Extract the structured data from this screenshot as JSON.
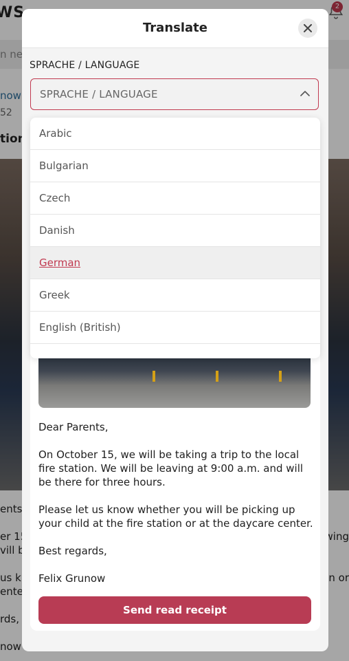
{
  "background": {
    "brand_partial": "WS",
    "notification_count": "2",
    "search_partial": "n new",
    "author_partial": "now",
    "time_partial": "52",
    "title_partial": "tion",
    "lines": [
      {
        "left": "ents,",
        "right": ""
      },
      {
        "left": "er 15",
        "right": "wing"
      },
      {
        "left": "vill be",
        "right": ""
      },
      {
        "left": "us k",
        "right": "n or"
      },
      {
        "left": "enter",
        "right": ""
      },
      {
        "left": "rds,",
        "right": ""
      },
      {
        "left": "now",
        "right": ""
      }
    ]
  },
  "modal": {
    "title": "Translate",
    "language_label": "SPRACHE / LANGUAGE",
    "select_placeholder": "SPRACHE / LANGUAGE",
    "options": [
      "Arabic",
      "Bulgarian",
      "Czech",
      "Danish",
      "German",
      "Greek",
      "English (British)"
    ],
    "selected_option": "German",
    "post": {
      "greeting": "Dear Parents,",
      "paragraph1": "On October 15, we will be taking a trip to the local fire station. We will be leaving at 9:00 a.m. and will be there for three hours.",
      "paragraph2": "Please let us know whether you will be picking up your child at the fire station or at the daycare center.",
      "closing": "Best regards,",
      "signature": "Felix Grunow"
    },
    "receipt_button": "Send read receipt"
  },
  "colors": {
    "accent": "#b83c54",
    "selected_text": "#c0394f"
  },
  "icons": {
    "close": "close-icon",
    "chevron": "chevron-up-icon",
    "bell": "bell-icon"
  }
}
